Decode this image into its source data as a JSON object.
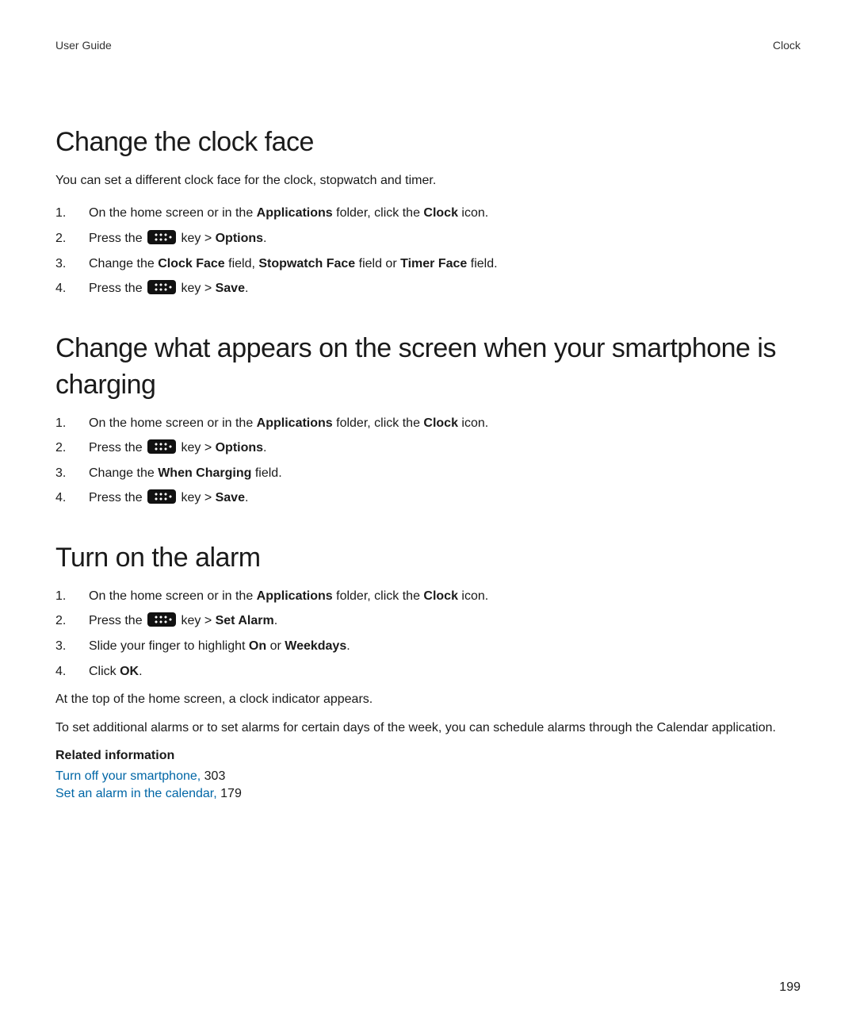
{
  "header": {
    "left": "User Guide",
    "right": "Clock"
  },
  "section1": {
    "heading": "Change the clock face",
    "intro": "You can set a different clock face for the clock, stopwatch and timer.",
    "steps": {
      "s1": {
        "a": "On the home screen or in the ",
        "b": "Applications",
        "c": " folder, click the ",
        "d": "Clock",
        "e": " icon."
      },
      "s2": {
        "a": "Press the ",
        "b": " key > ",
        "c": "Options",
        "d": "."
      },
      "s3": {
        "a": "Change the ",
        "b": "Clock Face",
        "c": " field, ",
        "d": "Stopwatch Face",
        "e": " field or ",
        "f": "Timer Face",
        "g": " field."
      },
      "s4": {
        "a": "Press the ",
        "b": " key > ",
        "c": "Save",
        "d": "."
      }
    }
  },
  "section2": {
    "heading": "Change what appears on the screen when your smartphone is charging",
    "steps": {
      "s1": {
        "a": "On the home screen or in the ",
        "b": "Applications",
        "c": " folder, click the ",
        "d": "Clock",
        "e": " icon."
      },
      "s2": {
        "a": "Press the ",
        "b": " key > ",
        "c": "Options",
        "d": "."
      },
      "s3": {
        "a": "Change the ",
        "b": "When Charging",
        "c": " field."
      },
      "s4": {
        "a": "Press the ",
        "b": " key > ",
        "c": "Save",
        "d": "."
      }
    }
  },
  "section3": {
    "heading": "Turn on the alarm",
    "steps": {
      "s1": {
        "a": "On the home screen or in the ",
        "b": "Applications",
        "c": " folder, click the ",
        "d": "Clock",
        "e": " icon."
      },
      "s2": {
        "a": "Press the ",
        "b": " key > ",
        "c": "Set Alarm",
        "d": "."
      },
      "s3": {
        "a": "Slide your finger to highlight ",
        "b": "On",
        "c": " or ",
        "d": "Weekdays",
        "e": "."
      },
      "s4": {
        "a": "Click ",
        "b": "OK",
        "c": "."
      }
    },
    "after1": "At the top of the home screen, a clock indicator appears.",
    "after2": "To set additional alarms or to set alarms for certain days of the week, you can schedule alarms through the Calendar application.",
    "relatedHeading": "Related information",
    "related": [
      {
        "text": "Turn off your smartphone,",
        "page": "303"
      },
      {
        "text": "Set an alarm in the calendar,",
        "page": "179"
      }
    ]
  },
  "pageNumber": "199"
}
